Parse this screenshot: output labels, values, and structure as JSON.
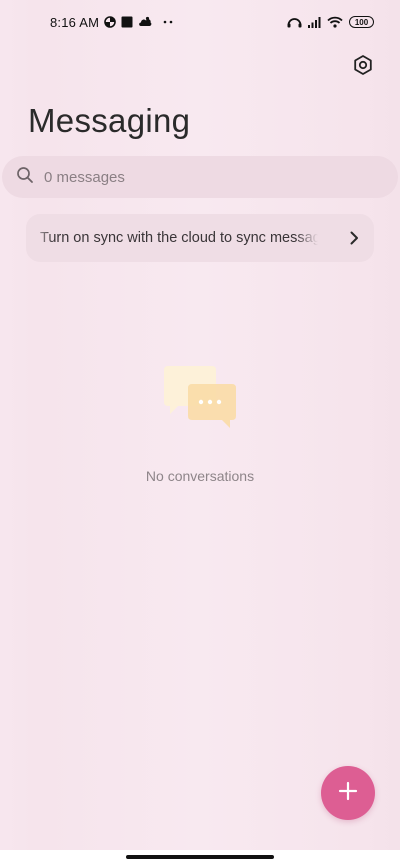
{
  "status_bar": {
    "time": "8:16 AM",
    "battery": "100",
    "left_icons": [
      "pie-chart-icon",
      "square-icon",
      "cloud-icon",
      "more-dots-icon"
    ],
    "right_icons": [
      "headphones-icon",
      "signal-icon",
      "wifi-icon",
      "battery-icon"
    ]
  },
  "header": {
    "title": "Messaging",
    "settings_icon": "settings-hexagon-icon"
  },
  "search": {
    "placeholder": "0 messages",
    "icon": "search-icon"
  },
  "sync_banner": {
    "text": "Turn on sync with the cloud to sync messages",
    "icon": "chevron-right-icon"
  },
  "empty_state": {
    "illustration": "chat-bubbles-icon",
    "text": "No conversations"
  },
  "fab": {
    "icon": "plus-icon",
    "color": "#dd5e93"
  },
  "colors": {
    "accent": "#dd5e93",
    "background": "#f8e9f0",
    "surface": "#eedae3"
  }
}
